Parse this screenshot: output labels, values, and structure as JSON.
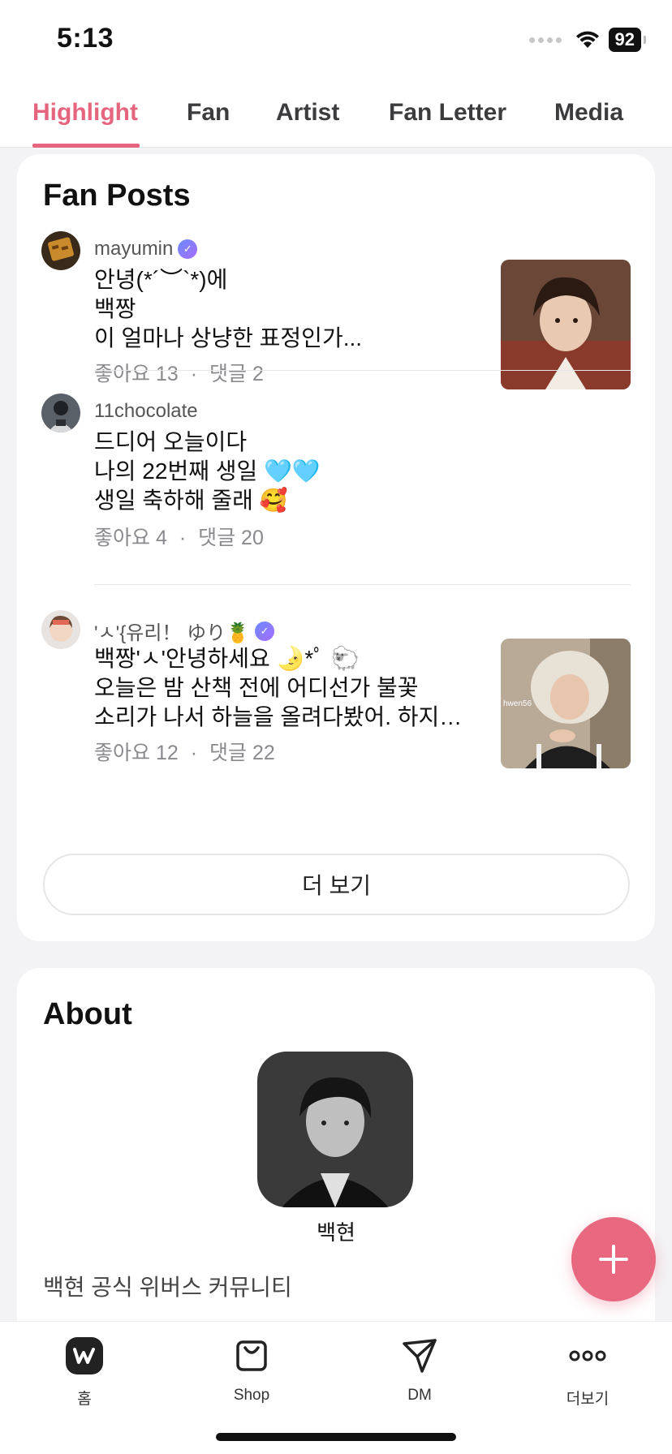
{
  "status_bar": {
    "time": "5:13",
    "battery": "92"
  },
  "tabs": [
    {
      "label": "Highlight",
      "active": true
    },
    {
      "label": "Fan",
      "active": false
    },
    {
      "label": "Artist",
      "active": false
    },
    {
      "label": "Fan Letter",
      "active": false
    },
    {
      "label": "Media",
      "active": false
    }
  ],
  "fan_posts": {
    "title": "Fan Posts",
    "posts": [
      {
        "username": "mayumin",
        "verified": true,
        "text": "안녕(*´︶`*)에\n백짱\n이 얼마나 상냥한 표정인가...",
        "likes": "좋아요 13",
        "comments": "댓글 2",
        "has_image": true
      },
      {
        "username": "11chocolate",
        "verified": false,
        "text": "드디어 오늘이다\n나의 22번째 생일 🩵🩵\n생일 축하해 줄래 🥰",
        "likes": "좋아요 4",
        "comments": "댓글 20",
        "has_image": false
      },
      {
        "username": "'ㅅ'{유리！ ゆり🍍",
        "verified": true,
        "text": "백짱'ㅅ'안녕하세요 🌛*ﾟ 🐑\n오늘은 밤 산책 전에 어디선가 불꽃\n소리가 나서 하늘을 올려다봤어. 하지…",
        "likes": "좋아요 12",
        "comments": "댓글 22",
        "has_image": true,
        "image_caption": "hwen56"
      }
    ],
    "more_button": "더 보기",
    "meta_separator": "·"
  },
  "about": {
    "title": "About",
    "artist_name": "백현",
    "description": "백현 공식 위버스 커뮤니티"
  },
  "bottom_nav": [
    {
      "label": "홈",
      "icon": "weverse-home-icon"
    },
    {
      "label": "Shop",
      "icon": "shopping-bag-icon"
    },
    {
      "label": "DM",
      "icon": "paper-plane-icon"
    },
    {
      "label": "더보기",
      "icon": "more-dots-icon"
    }
  ],
  "colors": {
    "accent": "#e5657e",
    "fab": "#e8687f"
  }
}
